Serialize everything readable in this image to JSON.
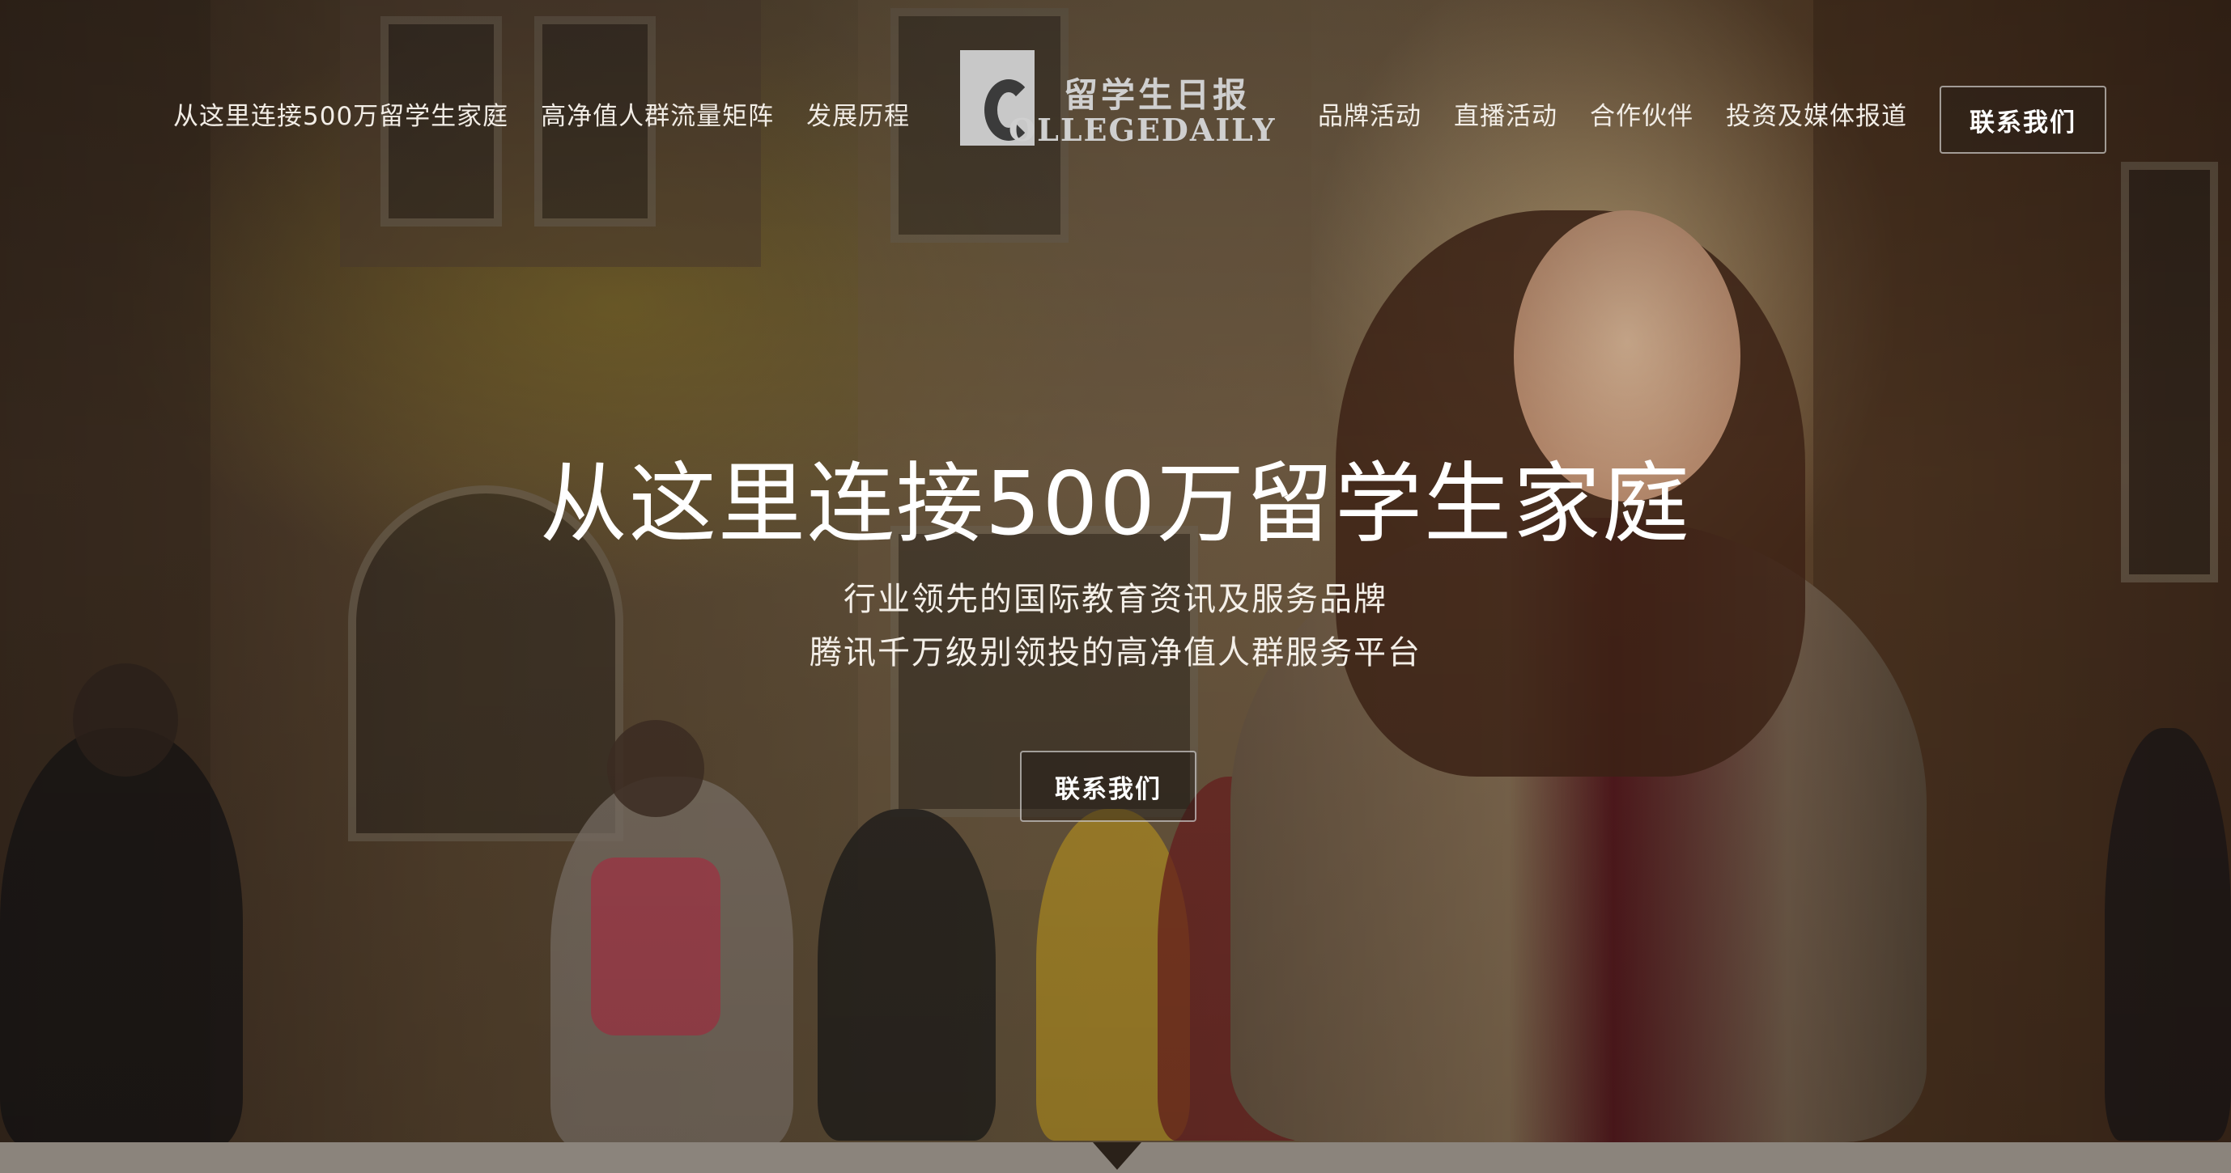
{
  "nav": {
    "left_items": [
      {
        "label": "从这里连接500万留学生家庭"
      },
      {
        "label": "高净值人群流量矩阵"
      },
      {
        "label": "发展历程"
      }
    ],
    "right_items": [
      {
        "label": "品牌活动"
      },
      {
        "label": "直播活动"
      },
      {
        "label": "合作伙伴"
      },
      {
        "label": "投资及媒体报道"
      }
    ],
    "contact_label": "联系我们"
  },
  "logo": {
    "cn_text": "留学生日报",
    "en_text": "OLLEGEDAILY"
  },
  "hero": {
    "title": "从这里连接500万留学生家庭",
    "subtitle_line1": "行业领先的国际教育资讯及服务品牌",
    "subtitle_line2": "腾讯千万级别领投的高净值人群服务平台",
    "cta_label": "联系我们"
  },
  "colors": {
    "text": "#ffffff",
    "bottom_bar": "#8b847c"
  }
}
